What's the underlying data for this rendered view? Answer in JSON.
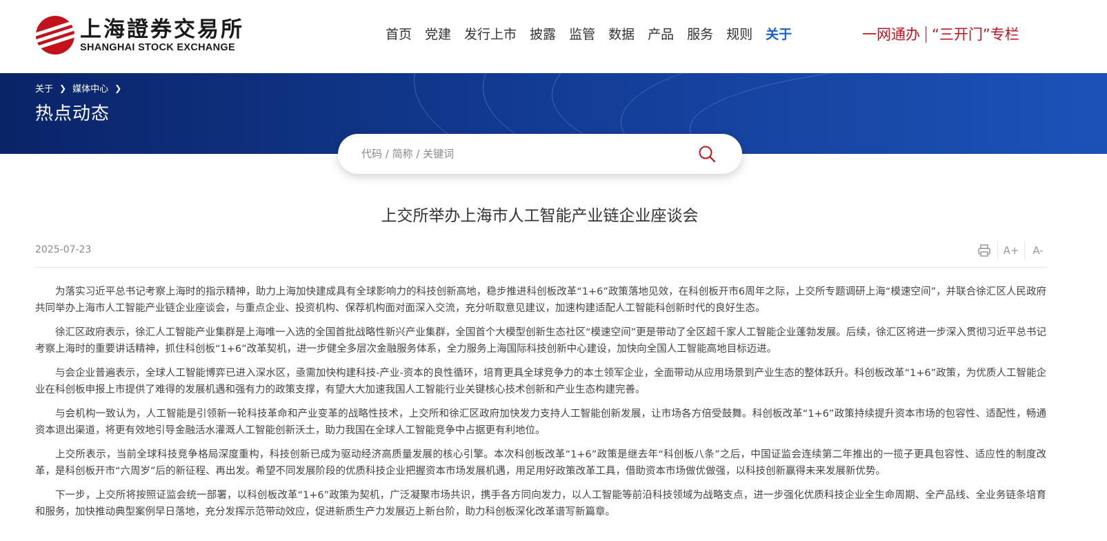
{
  "header": {
    "logo_cn": "上海證券交易所",
    "logo_en": "SHANGHAI STOCK EXCHANGE",
    "nav": [
      "首页",
      "党建",
      "发行上市",
      "披露",
      "监管",
      "数据",
      "产品",
      "服务",
      "规则",
      "关于"
    ],
    "active_nav": "关于",
    "special_links": [
      "一网通办",
      "“三开门”专栏"
    ]
  },
  "banner": {
    "breadcrumb": [
      "关于",
      "媒体中心"
    ],
    "title": "热点动态"
  },
  "search": {
    "placeholder": "代码 / 简称 / 关键词"
  },
  "article": {
    "title": "上交所举办上海市人工智能产业链企业座谈会",
    "date": "2025-07-23",
    "tools": {
      "print_icon": "printer-icon",
      "increase_font": "A+",
      "decrease_font": "A-"
    },
    "paragraphs": [
      "为落实习近平总书记考察上海时的指示精神，助力上海加快建成具有全球影响力的科技创新高地，稳步推进科创板改革“1+6”政策落地见效，在科创板开市6周年之际，上交所专题调研上海“模速空间”，并联合徐汇区人民政府共同举办上海市人工智能产业链企业座谈会，与重点企业、投资机构、保荐机构面对面深入交流，充分听取意见建议，加速构建适配人工智能科创新时代的良好生态。",
      "徐汇区政府表示，徐汇人工智能产业集群是上海唯一入选的全国首批战略性新兴产业集群，全国首个大模型创新生态社区“模速空间”更是带动了全区超千家人工智能企业蓬勃发展。后续，徐汇区将进一步深入贯彻习近平总书记考察上海时的重要讲话精神，抓住科创板“1+6”改革契机，进一步健全多层次金融服务体系，全力服务上海国际科技创新中心建设，加快向全国人工智能高地目标迈进。",
      "与会企业普遍表示，全球人工智能博弈已进入深水区，亟需加快构建科技-产业-资本的良性循环，培育更具全球竞争力的本土领军企业，全面带动从应用场景到产业生态的整体跃升。科创板改革“1+6”政策，为优质人工智能企业在科创板申报上市提供了难得的发展机遇和强有力的政策支撑，有望大大加速我国人工智能行业关键核心技术创新和产业生态构建完善。",
      "与会机构一致认为，人工智能是引领新一轮科技革命和产业变革的战略性技术，上交所和徐汇区政府加快发力支持人工智能创新发展，让市场各方倍受鼓舞。科创板改革“1+6”政策持续提升资本市场的包容性、适配性，畅通资本退出渠道，将更有效地引导金融活水灌溉人工智能创新沃土，助力我国在全球人工智能竞争中占据更有利地位。",
      "上交所表示，当前全球科技竞争格局深度重构，科技创新已成为驱动经济高质量发展的核心引擎。本次科创板改革“1+6”政策是继去年“科创板八条”之后，中国证监会连续第二年推出的一揽子更具包容性、适应性的制度改革，是科创板开市“六周岁”后的新征程、再出发。希望不同发展阶段的优质科技企业把握资本市场发展机遇，用足用好政策改革工具，借助资本市场做优做强，以科技创新赢得未来发展新优势。",
      "下一步，上交所将按照证监会统一部署，以科创板改革“1+6”政策为契机，广泛凝聚市场共识，携手各方同向发力，以人工智能等前沿科技领域为战略支点，进一步强化优质科技企业全生命周期、全产品线、全业务链条培育和服务，加快推动典型案例早日落地，充分发挥示范带动效应，促进新质生产力发展迈上新台阶，助力科创板深化改革谱写新篇章。"
    ]
  }
}
